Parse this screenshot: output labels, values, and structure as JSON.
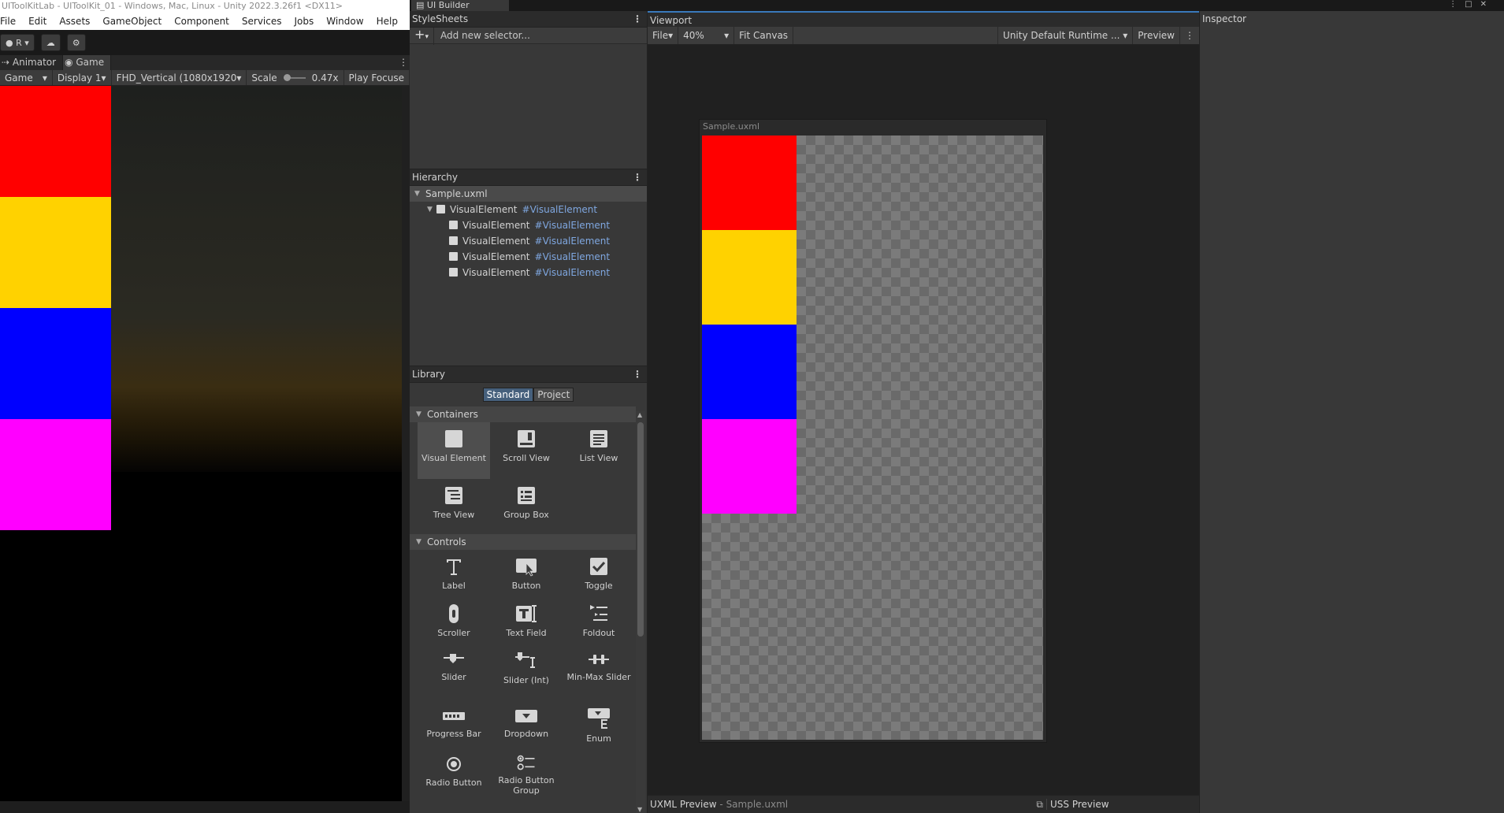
{
  "unity": {
    "title": "UIToolKitLab - UIToolKit_01 - Windows, Mac, Linux - Unity 2022.3.26f1 <DX11>",
    "menu": [
      "File",
      "Edit",
      "Assets",
      "GameObject",
      "Component",
      "Services",
      "Jobs",
      "Window",
      "Help"
    ],
    "toolbar": {
      "account_label": "R"
    },
    "tabs": {
      "animator": "Animator",
      "game": "Game"
    },
    "game_controls": {
      "mode": "Game",
      "display": "Display 1",
      "resolution": "FHD_Vertical (1080x1920",
      "scale_label": "Scale",
      "scale_value": "0.47x",
      "play_focus": "Play Focuse"
    },
    "game_blocks": [
      "#ff0000",
      "#ffd200",
      "#0000ff",
      "#ff00ff"
    ]
  },
  "builder": {
    "window_tab": "UI Builder",
    "stylesheets": {
      "title": "StyleSheets",
      "add_placeholder": "Add new selector..."
    },
    "hierarchy": {
      "title": "Hierarchy",
      "root": "Sample.uxml",
      "parent": {
        "type": "VisualElement",
        "selector": "#VisualElement"
      },
      "children": [
        {
          "type": "VisualElement",
          "selector": "#VisualElement"
        },
        {
          "type": "VisualElement",
          "selector": "#VisualElement"
        },
        {
          "type": "VisualElement",
          "selector": "#VisualElement"
        },
        {
          "type": "VisualElement",
          "selector": "#VisualElement"
        }
      ]
    },
    "library": {
      "title": "Library",
      "tabs": [
        "Standard",
        "Project"
      ],
      "containers_header": "Containers",
      "containers": [
        {
          "label": "Visual Element",
          "icon": "visual-element-icon"
        },
        {
          "label": "Scroll View",
          "icon": "scroll-view-icon"
        },
        {
          "label": "List View",
          "icon": "list-view-icon"
        },
        {
          "label": "Tree View",
          "icon": "tree-view-icon"
        },
        {
          "label": "Group Box",
          "icon": "group-box-icon"
        }
      ],
      "controls_header": "Controls",
      "controls": [
        {
          "label": "Label",
          "icon": "label-icon"
        },
        {
          "label": "Button",
          "icon": "button-icon"
        },
        {
          "label": "Toggle",
          "icon": "toggle-icon"
        },
        {
          "label": "Scroller",
          "icon": "scroller-icon"
        },
        {
          "label": "Text Field",
          "icon": "text-field-icon"
        },
        {
          "label": "Foldout",
          "icon": "foldout-icon"
        },
        {
          "label": "Slider",
          "icon": "slider-icon"
        },
        {
          "label": "Slider (Int)",
          "icon": "slider-int-icon"
        },
        {
          "label": "Min-Max Slider",
          "icon": "min-max-slider-icon"
        },
        {
          "label": "Progress Bar",
          "icon": "progress-bar-icon"
        },
        {
          "label": "Dropdown",
          "icon": "dropdown-icon"
        },
        {
          "label": "Enum",
          "icon": "enum-icon"
        },
        {
          "label": "Radio Button",
          "icon": "radio-button-icon"
        },
        {
          "label": "Radio Button Group",
          "icon": "radio-button-group-icon"
        }
      ]
    },
    "viewport": {
      "title": "Viewport",
      "file_menu": "File",
      "zoom": "40%",
      "fit_canvas": "Fit Canvas",
      "theme": "Unity Default Runtime ...",
      "preview": "Preview",
      "canvas_label": "Sample.uxml",
      "blocks": [
        "#ff0000",
        "#ffd200",
        "#0000ff",
        "#ff00ff"
      ],
      "uxml_preview": "UXML Preview",
      "uxml_file": "Sample.uxml",
      "uss_preview": "USS Preview"
    },
    "inspector": {
      "title": "Inspector"
    }
  }
}
